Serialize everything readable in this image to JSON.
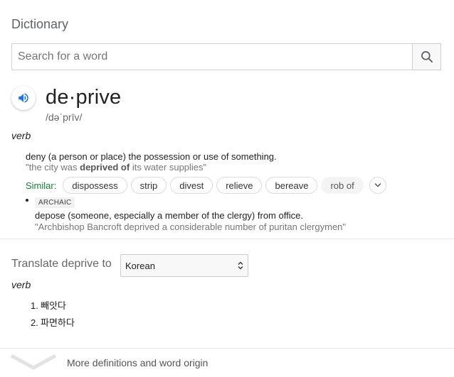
{
  "header": {
    "title": "Dictionary"
  },
  "search": {
    "placeholder": "Search for a word",
    "value": "",
    "icon": "search-icon"
  },
  "entry": {
    "word": "de·prive",
    "phonetic": "/dəˈprīv/",
    "audio_icon": "speaker-icon",
    "part_of_speech": "verb",
    "senses": [
      {
        "definition": "deny (a person or place) the possession or use of something.",
        "example_prefix": "\"the city was ",
        "example_bold": "deprived of",
        "example_suffix": " its water supplies\"",
        "similar_label": "Similar:",
        "similar": [
          "dispossess",
          "strip",
          "divest",
          "relieve",
          "bereave",
          "rob of"
        ]
      },
      {
        "tag": "ARCHAIC",
        "definition": "depose (someone, especially a member of the clergy) from office.",
        "example": "\"Archbishop Bancroft deprived a considerable number of puritan clergymen\""
      }
    ]
  },
  "translate": {
    "label": "Translate deprive to",
    "language": "Korean",
    "part_of_speech": "verb",
    "items": [
      {
        "num": "1.",
        "text": "빼앗다"
      },
      {
        "num": "2.",
        "text": "파면하다"
      }
    ]
  },
  "footer": {
    "more_label": "More definitions and word origin",
    "icon": "chevron-down-icon"
  },
  "colors": {
    "accent": "#1a73e8",
    "similar": "#188038",
    "muted": "#777777"
  }
}
